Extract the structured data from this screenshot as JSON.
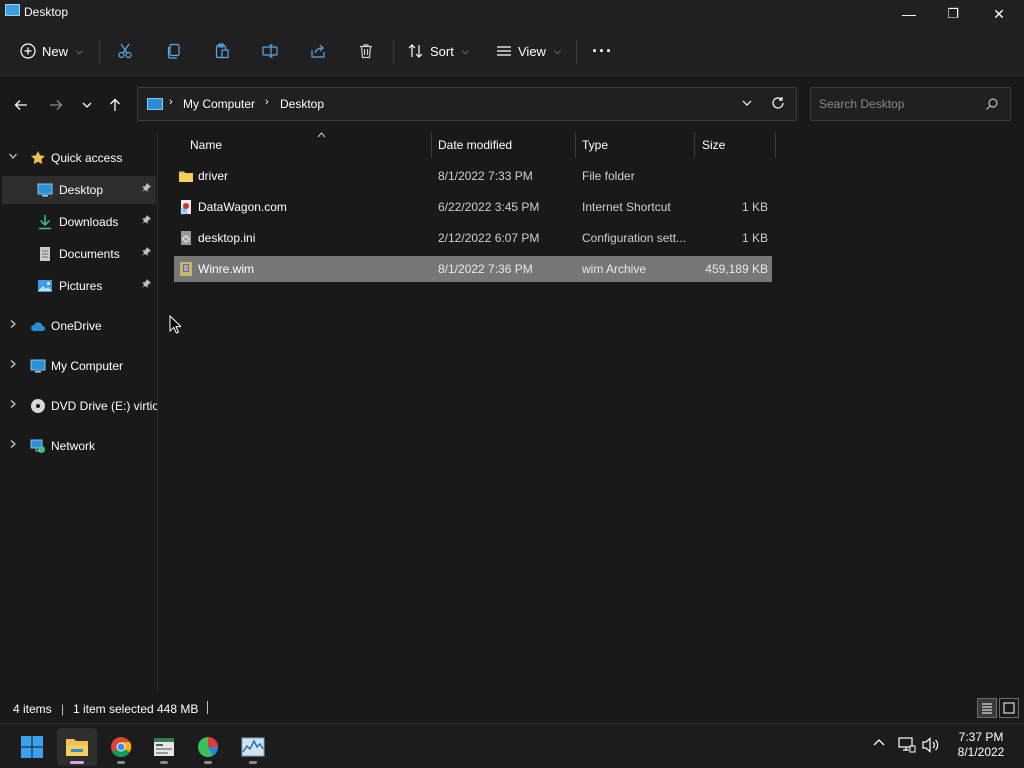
{
  "window": {
    "title": "Desktop",
    "minimize_glyph": "—",
    "maximize_glyph": "❐",
    "close_glyph": "✕"
  },
  "toolbar": {
    "new_label": "New",
    "sort_label": "Sort",
    "view_label": "View",
    "more_glyph": "···",
    "icons": [
      "cut-icon",
      "copy-icon",
      "paste-icon",
      "rename-icon",
      "share-icon",
      "delete-icon"
    ]
  },
  "address": {
    "crumbs": [
      "My Computer",
      "Desktop"
    ],
    "separator": "›"
  },
  "search": {
    "placeholder": "Search Desktop"
  },
  "sidebar": {
    "quick_access": "Quick access",
    "items": [
      {
        "label": "Desktop",
        "icon": "desktop-icon",
        "pinned": true,
        "selected": true
      },
      {
        "label": "Downloads",
        "icon": "download-icon",
        "pinned": true
      },
      {
        "label": "Documents",
        "icon": "documents-icon",
        "pinned": true
      },
      {
        "label": "Pictures",
        "icon": "pictures-icon",
        "pinned": true
      }
    ],
    "roots": [
      {
        "label": "OneDrive",
        "icon": "cloud-icon"
      },
      {
        "label": "My Computer",
        "icon": "computer-icon"
      },
      {
        "label": "DVD Drive (E:) virtio-",
        "icon": "dvd-icon"
      },
      {
        "label": "Network",
        "icon": "network-icon"
      }
    ],
    "pin_glyph": "📌"
  },
  "columns": {
    "name": "Name",
    "date": "Date modified",
    "type": "Type",
    "size": "Size"
  },
  "files": [
    {
      "name": "driver",
      "date": "8/1/2022 7:33 PM",
      "type": "File folder",
      "size": "",
      "icon": "folder-icon"
    },
    {
      "name": "DataWagon.com",
      "date": "6/22/2022 3:45 PM",
      "type": "Internet Shortcut",
      "size": "1 KB",
      "icon": "shortcut-icon"
    },
    {
      "name": "desktop.ini",
      "date": "2/12/2022 6:07 PM",
      "type": "Configuration sett...",
      "size": "1 KB",
      "icon": "settings-file-icon"
    },
    {
      "name": "Winre.wim",
      "date": "8/1/2022 7:36 PM",
      "type": "wim Archive",
      "size": "459,189 KB",
      "icon": "archive-icon",
      "selected": true
    }
  ],
  "status": {
    "count": "4 items",
    "divider": "|",
    "selection": "1 item selected",
    "selection_size": "448 MB"
  },
  "taskbar": {
    "apps": [
      "windows-start-icon",
      "file-explorer-icon",
      "chrome-icon",
      "app-window-icon",
      "chart-app-icon",
      "monitor-app-icon"
    ]
  },
  "clock": {
    "time": "7:37 PM",
    "date": "8/1/2022"
  },
  "colors": {
    "background": "#191919",
    "chrome": "#202020",
    "selection": "#777777",
    "folder": "#f2c14e",
    "accent": "#2b8fd6"
  }
}
